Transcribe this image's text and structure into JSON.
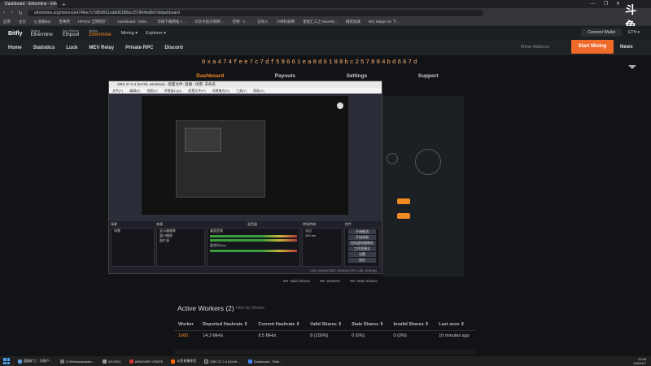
{
  "browser": {
    "tabs": [
      "Dashboard - Ethermine - Eth..."
    ],
    "new_tab_label": "+",
    "window_controls": [
      "—",
      "❐",
      "✕"
    ],
    "url": "ethermine.org/miners/a474fee7c7df59661ea8d6188bc257804bd667d/dashboard",
    "bookmarks": [
      "应用",
      "主页",
      "Q 金融BQ",
      "百事用",
      "HPOOL 全网挖矿...",
      "Dashboard - Ethe...",
      "华硕下载网站 1 ...",
      "众享点技巧到网 ...",
      "巴特 - 1 ...",
      "已导入",
      "小林科技网",
      "星星汇工之 NiceHE...",
      "微软加速",
      "NIC Magic 5G 下...",
      "下载分享 NIS 2 ...",
      "工具路由"
    ]
  },
  "watermark": "斗鱼",
  "site": {
    "brand": "Bitfly",
    "pools": [
      {
        "sub": "Staking",
        "name": "Ethermine"
      },
      {
        "sub": "Solo Staking",
        "name": "Ethpool"
      },
      {
        "sub": "Mining",
        "name": "Ethermine"
      }
    ],
    "menus": [
      "Mining ▾",
      "Explorer ▾"
    ],
    "connect_wallet": "Connect Wallet",
    "currency": "ETH ▾",
    "nav": [
      "Home",
      "Statistics",
      "Luck",
      "MEV Relay",
      "Private RPC",
      "Discord"
    ],
    "miner_address_placeholder": "Miner Address",
    "start_mining": "Start Mining",
    "news": "News",
    "wallet": "0xa474fee7c7df59661ea8d6188bc257804bd667d",
    "page_tabs": [
      "Dashboard",
      "Payouts",
      "Settings",
      "Support"
    ]
  },
  "obs": {
    "title": "OBS 27.2.4 (64-bit, windows) - 配置文件: 直播 - 场景: 未命名",
    "menu": [
      "文件(F)",
      "编辑(E)",
      "视图(V)",
      "停靠窗口(D)",
      "配置文件(P)",
      "场景集合(S)",
      "工具(T)",
      "帮助(H)"
    ],
    "docks": [
      "场景",
      "来源",
      "混音器",
      "转场特效",
      "控件"
    ],
    "scenes": [
      "场景"
    ],
    "sources": [
      "显示器捕获",
      "窗口捕获",
      "图片源"
    ],
    "mixer": [
      "桌面音频",
      "麦克风/Aux"
    ],
    "transition": [
      "淡出",
      "300 ms"
    ],
    "controls": [
      "开始推流",
      "开始录制",
      "启动虚拟摄像机",
      "工作室模式",
      "设置",
      "退出"
    ],
    "status": "LIVE: 00:00:00  REC: 00:00:00  CPU: 1.8%, 30.00 fps"
  },
  "chart_legend": [
    "Valid Shares",
    "Workers",
    "Stale Shares"
  ],
  "workers": {
    "title": "Active Workers (2)",
    "filter_placeholder": "Filter by Worker",
    "headers": [
      "Worker",
      "Reported Hashrate ⇕",
      "Current Hashrate ⇕",
      "Valid Shares ⇕",
      "Stale Shares ⇕",
      "Invalid Shares ⇕",
      "Last seen ⇕"
    ],
    "rows": [
      [
        "1060",
        "14.3 MH/s",
        "9.5 MH/s",
        "8 (100%)",
        "0 (0%)",
        "0 (0%)",
        "10 minutes ago"
      ]
    ]
  },
  "taskbar": {
    "items": [
      "超级矿工 - 为两户...",
      "C:\\Windows\\syste...",
      "4/1/2021",
      "ARMOURY CRATE",
      "斗鱼直播伴侣",
      "OBS 27.2.4 (64-bit...",
      "Dashboard - Ethe..."
    ],
    "time": "21:05",
    "date": "2022/1/7"
  },
  "colors": {
    "accent": "#f08a24",
    "start_button": "#f06a2a"
  }
}
